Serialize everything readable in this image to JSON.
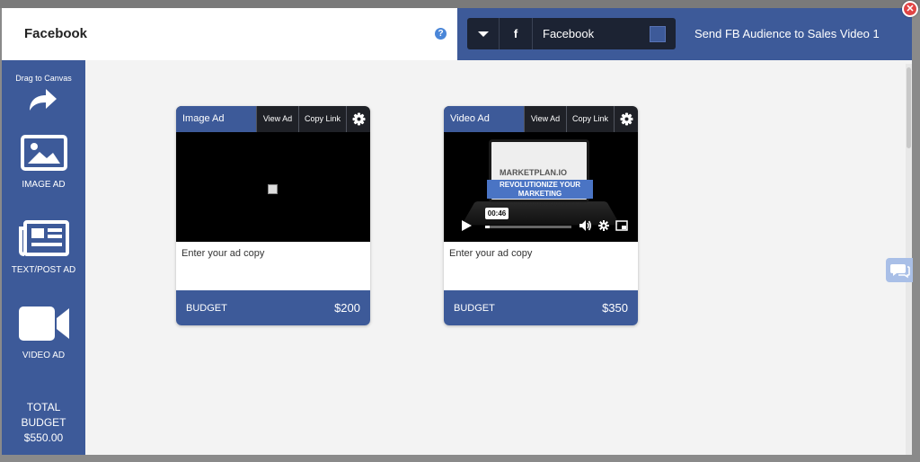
{
  "header": {
    "title": "Facebook",
    "help_icon": "question-icon",
    "platform": "Facebook",
    "platform_icon": "facebook-f-icon",
    "platform_color": "#3d5a99",
    "campaign_name": "Send FB Audience to Sales Video 1"
  },
  "sidebar": {
    "drag_label": "Drag to Canvas",
    "tools": [
      {
        "label": "IMAGE AD",
        "icon": "image-icon"
      },
      {
        "label": "TEXT/POST AD",
        "icon": "newspaper-icon"
      },
      {
        "label": "VIDEO AD",
        "icon": "video-camera-icon"
      }
    ],
    "total_label_1": "TOTAL",
    "total_label_2": "BUDGET",
    "total_value": "$550.00"
  },
  "cards": [
    {
      "type": "Image Ad",
      "view_label": "View Ad",
      "copy_label": "Copy Link",
      "ad_copy": "Enter your ad copy",
      "budget_label": "BUDGET",
      "budget_value": "$200"
    },
    {
      "type": "Video Ad",
      "view_label": "View Ad",
      "copy_label": "Copy Link",
      "ad_copy": "Enter your ad copy",
      "budget_label": "BUDGET",
      "budget_value": "$350",
      "video": {
        "brand_1": "MARKET",
        "brand_2": "PLAN.IO",
        "banner_1": "REVOLUTIONIZE YOUR",
        "banner_2": "MARKETING",
        "time": "00:46",
        "progress": 0.05
      }
    }
  ],
  "colors": {
    "accent": "#3d5a99",
    "dark": "#1f2127",
    "close": "#e04545"
  }
}
